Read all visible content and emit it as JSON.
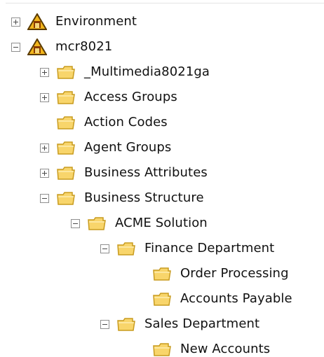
{
  "tree": {
    "nodes": [
      {
        "label": "Environment",
        "state": "collapsed",
        "icon": "environment-warning-icon"
      },
      {
        "label": "mcr8021",
        "state": "expanded",
        "icon": "environment-warning-icon"
      },
      {
        "label": "_Multimedia8021ga",
        "state": "collapsed",
        "icon": "folder-icon"
      },
      {
        "label": "Access Groups",
        "state": "collapsed",
        "icon": "folder-icon"
      },
      {
        "label": "Action Codes",
        "state": "leaf",
        "icon": "folder-icon"
      },
      {
        "label": "Agent Groups",
        "state": "collapsed",
        "icon": "folder-icon"
      },
      {
        "label": "Business Attributes",
        "state": "collapsed",
        "icon": "folder-icon"
      },
      {
        "label": "Business Structure",
        "state": "expanded",
        "icon": "folder-icon"
      },
      {
        "label": "ACME Solution",
        "state": "expanded",
        "icon": "folder-icon"
      },
      {
        "label": "Finance Department",
        "state": "expanded",
        "icon": "folder-icon"
      },
      {
        "label": "Order Processing",
        "state": "leaf",
        "icon": "folder-icon"
      },
      {
        "label": "Accounts Payable",
        "state": "leaf",
        "icon": "folder-icon"
      },
      {
        "label": "Sales Department",
        "state": "expanded",
        "icon": "folder-icon"
      },
      {
        "label": "New Accounts",
        "state": "leaf",
        "icon": "folder-icon"
      }
    ]
  },
  "colors": {
    "folder_fill": "#f8d56b",
    "folder_outline": "#c89b1f",
    "warning_fill": "#f2b51b",
    "warning_outline": "#5a3b00"
  }
}
